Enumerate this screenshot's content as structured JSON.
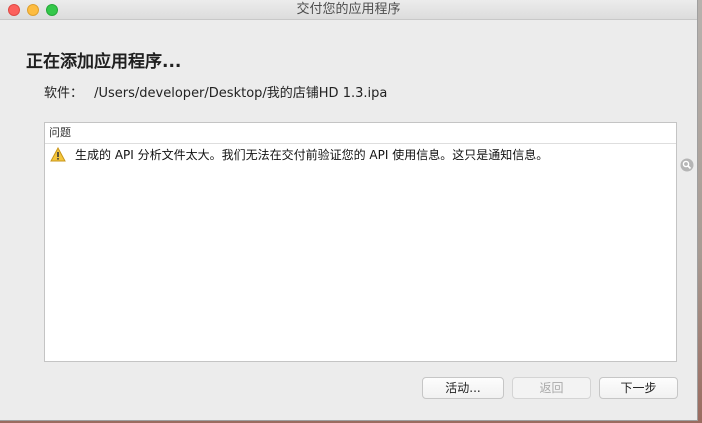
{
  "window": {
    "title": "交付您的应用程序"
  },
  "heading": "正在添加应用程序...",
  "file": {
    "label": "软件：",
    "path": "/Users/developer/Desktop/我的店铺HD 1.3.ipa"
  },
  "issues": {
    "header": "问题",
    "items": [
      {
        "icon": "warning-icon",
        "text": "生成的 API 分析文件太大。我们无法在交付前验证您的 API 使用信息。这只是通知信息。"
      }
    ]
  },
  "buttons": {
    "activity": "活动...",
    "back": "返回",
    "next": "下一步"
  },
  "colors": {
    "warning": "#f4c63d",
    "close": "#fc605c",
    "minimize": "#fdbc40",
    "maximize": "#34c84a"
  }
}
